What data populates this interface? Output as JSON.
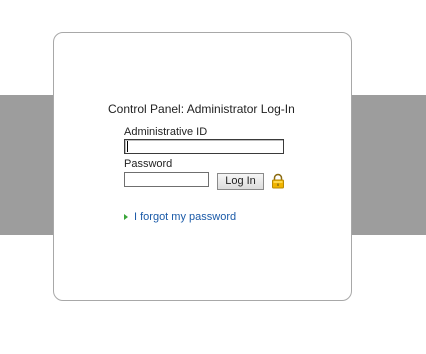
{
  "login": {
    "title": "Control Panel: Administrator Log-In",
    "id_label": "Administrative ID",
    "id_value": "",
    "password_label": "Password",
    "password_value": "",
    "login_button": "Log In",
    "lock_icon": "padlock-icon",
    "forgot_link": "I forgot my password"
  },
  "colors": {
    "band": "#9d9d9d",
    "card_border": "#a8a8a8",
    "link": "#1a5aa8",
    "bullet": "#3aa53a",
    "lock": "#f0b400"
  }
}
